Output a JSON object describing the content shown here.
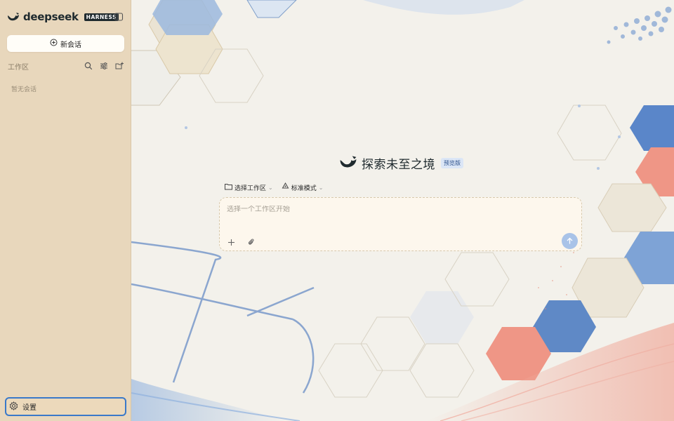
{
  "sidebar": {
    "brand_name": "deepseek",
    "brand_badge": "HARNESS",
    "new_chat_label": "新会话",
    "workspace_title": "工作区",
    "empty_text": "暂无会话",
    "settings_label": "设置"
  },
  "main": {
    "hero_title": "探索未至之境",
    "hero_badge": "预览版",
    "workspace_select": "选择工作区",
    "mode_select": "标准模式",
    "composer_placeholder": "选择一个工作区开始"
  },
  "icons": {
    "collapse": "sidebar-toggle-icon",
    "new_chat": "plus-circle-icon",
    "search": "search-icon",
    "filter": "sliders-icon",
    "new_folder": "folder-plus-icon",
    "settings": "gear-icon",
    "folder": "folder-icon",
    "mode": "recycle-icon",
    "add": "plus-icon",
    "attach": "paperclip-icon",
    "send": "arrow-up-icon"
  },
  "colors": {
    "sidebar_bg": "#e8d7bc",
    "accent_blue": "#3a79c9",
    "send_button": "#a9c3e8"
  }
}
